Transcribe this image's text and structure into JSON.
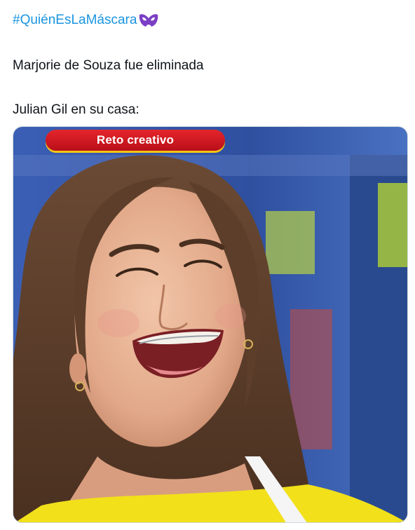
{
  "tweet": {
    "hashtag": "#QuiénEsLaMáscara",
    "hashtag_icon": "mask-emoji-icon",
    "line1": "Marjorie de Souza fue eliminada",
    "line2": "Julian Gil en su casa:"
  },
  "media": {
    "banner_text": "Reto creativo"
  },
  "colors": {
    "link": "#1b95e0",
    "mask_icon": "#7b3fc4",
    "banner_red": "#d41d25"
  }
}
